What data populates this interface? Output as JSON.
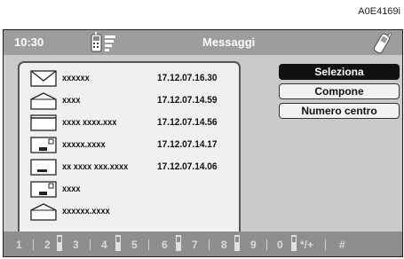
{
  "reference_code": "A0E4169i",
  "header": {
    "time": "10:30",
    "title": "Messaggi",
    "phone_icon": "phone-signal-icon",
    "antenna_icon": "mobile-phone-icon"
  },
  "messages": [
    {
      "icon": "envelope-unread-icon",
      "name": "xxxxxx",
      "date": "17.12.07.16.30"
    },
    {
      "icon": "envelope-read-icon",
      "name": "xxxx",
      "date": "17.12.07.14.59"
    },
    {
      "icon": "message-draft-icon",
      "name": "xxxx xxxx.xxx",
      "date": "17.12.07.14.56"
    },
    {
      "icon": "message-sent-icon",
      "name": "xxxxx.xxxx",
      "date": "17.12.07.14.17"
    },
    {
      "icon": "message-outbox-icon",
      "name": "xx xxxx xxx.xxxx",
      "date": "17.12.07.14.06"
    },
    {
      "icon": "message-sent-icon",
      "name": "xxxx",
      "date": ""
    },
    {
      "icon": "envelope-read-icon",
      "name": "xxxxxx.xxxx",
      "date": ""
    }
  ],
  "menu": {
    "select_label": "Seleziona",
    "compose_label": "Compone",
    "center_number_label": "Numero centro"
  },
  "keypad": {
    "k1": "1",
    "k2": "2",
    "k3": "3",
    "k4": "4",
    "k5": "5",
    "k6": "6",
    "k7": "7",
    "k8": "8",
    "k9": "9",
    "k0": "0",
    "kstar": "*/+",
    "khash": "#"
  },
  "colors": {
    "title_bar": "#9d9d9d",
    "screen_background": "#cacaca",
    "selected_button": "#111111",
    "keypad_bar": "#8e8e8e"
  }
}
